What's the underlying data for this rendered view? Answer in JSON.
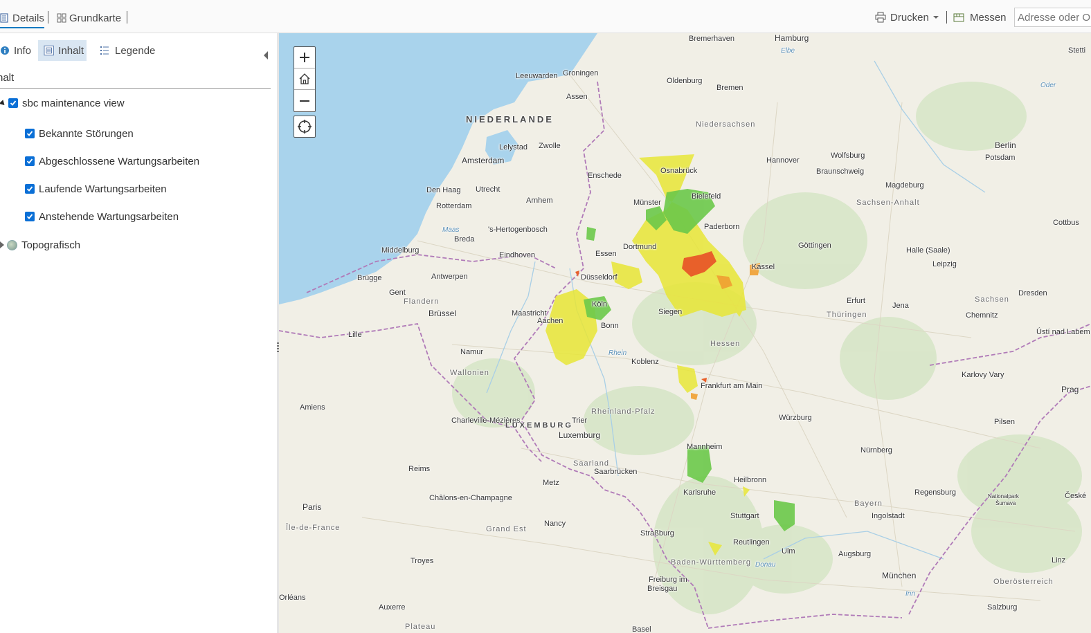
{
  "toolbar": {
    "details_label": "Details",
    "basemap_label": "Grundkarte",
    "print_label": "Drucken",
    "measure_label": "Messen",
    "search_placeholder": "Adresse oder O"
  },
  "panel": {
    "tabs": {
      "info": "Info",
      "content": "Inhalt",
      "legend": "Legende"
    },
    "heading": "halt",
    "layers": {
      "group": "sbc maintenance view",
      "sub": [
        "Bekannte Störungen",
        "Abgeschlossene Wartungsarbeiten",
        "Laufende Wartungsarbeiten",
        "Anstehende Wartungsarbeiten"
      ],
      "basemap": "Topografisch"
    }
  },
  "map": {
    "labels": {
      "bremerhaven": "Bremerhaven",
      "hamburg": "Hamburg",
      "leeuwarden": "Leeuwarden",
      "groningen": "Groningen",
      "assen": "Assen",
      "oldenburg": "Oldenburg",
      "bremen": "Bremen",
      "niederlande": "NIEDERLANDE",
      "niedersachsen": "Niedersachsen",
      "lelystad": "Lelystad",
      "zwolle": "Zwolle",
      "amsterdam": "Amsterdam",
      "wolfsburg": "Wolfsburg",
      "berlin": "Berlin",
      "osnabrueck": "Osnabrück",
      "hannover": "Hannover",
      "braunschweig": "Braunschweig",
      "potsdam": "Potsdam",
      "enschede": "Enschede",
      "den_haag": "Den Haag",
      "utrecht": "Utrecht",
      "magdeburg": "Magdeburg",
      "rotterdam": "Rotterdam",
      "arnhem": "Arnhem",
      "muenster": "Münster",
      "bielefeld": "Bielefeld",
      "sachsen_anhalt": "Sachsen-Anhalt",
      "cottbus": "Cottbus",
      "maas": "Maas",
      "hertogenbosch": "'s-Hertogenbosch",
      "paderborn": "Paderborn",
      "breda": "Breda",
      "dortmund": "Dortmund",
      "goettingen": "Göttingen",
      "halle": "Halle (Saale)",
      "middelburg": "Middelburg",
      "eindhoven": "Eindhoven",
      "essen": "Essen",
      "kassel": "Kassel",
      "leipzig": "Leipzig",
      "bruegge": "Brügge",
      "antwerpen": "Antwerpen",
      "duesseldorf": "Düsseldorf",
      "gent": "Gent",
      "flandern": "Flandern",
      "koeln": "Köln",
      "erfurt": "Erfurt",
      "jena": "Jena",
      "dresden": "Dresden",
      "sachsen": "Sachsen",
      "bruessel": "Brüssel",
      "maastricht": "Maastricht",
      "aachen": "Aachen",
      "siegen": "Siegen",
      "thueringen": "Thüringen",
      "chemnitz": "Chemnitz",
      "bonn": "Bonn",
      "usti": "Ústí nad Labem",
      "lille": "Lille",
      "hessen": "Hessen",
      "namur": "Namur",
      "rhein": "Rhein",
      "wallonien": "Wallonien",
      "koblenz": "Koblenz",
      "karlovy_vary": "Karlovy Vary",
      "frankfurt": "Frankfurt am Main",
      "prag": "Prag",
      "amiens": "Amiens",
      "rheinland_pfalz": "Rheinland-Pfalz",
      "charleville": "Charleville-Mézières",
      "trier": "Trier",
      "wuerzburg": "Würzburg",
      "pilsen": "Pilsen",
      "luxemburg_country": "LUXEMBURG",
      "luxemburg": "Luxemburg",
      "mannheim": "Mannheim",
      "nuernberg": "Nürnberg",
      "saarland": "Saarland",
      "reims": "Reims",
      "saarbruecken": "Saarbrücken",
      "heilbronn": "Heilbronn",
      "metz": "Metz",
      "karlsruhe": "Karlsruhe",
      "regensburg": "Regensburg",
      "chalons": "Châlons-en-Champagne",
      "bayern": "Bayern",
      "nationalpark": "Nationalpark",
      "sumava": "Šumava",
      "ceske": "České",
      "paris": "Paris",
      "stuttgart": "Stuttgart",
      "ingolstadt": "Ingolstadt",
      "ile_de_france": "Île-de-France",
      "grand_est": "Grand Est",
      "nancy": "Nancy",
      "strassburg": "Straßburg",
      "reutlingen": "Reutlingen",
      "ulm": "Ulm",
      "augsburg": "Augsburg",
      "linz": "Linz",
      "troyes": "Troyes",
      "bw": "Baden-Württemberg",
      "donau": "Donau",
      "muenchen": "München",
      "freiburg": "Freiburg im",
      "breisgau": "Breisgau",
      "oberoesterreich": "Oberösterreich",
      "inn": "Inn",
      "orleans": "Orléans",
      "auxerre": "Auxerre",
      "salzburg": "Salzburg",
      "elbe": "Elbe",
      "oder": "Oder",
      "plateau": "Plateau",
      "stettin": "Stetti",
      "basel": "Basel"
    }
  }
}
